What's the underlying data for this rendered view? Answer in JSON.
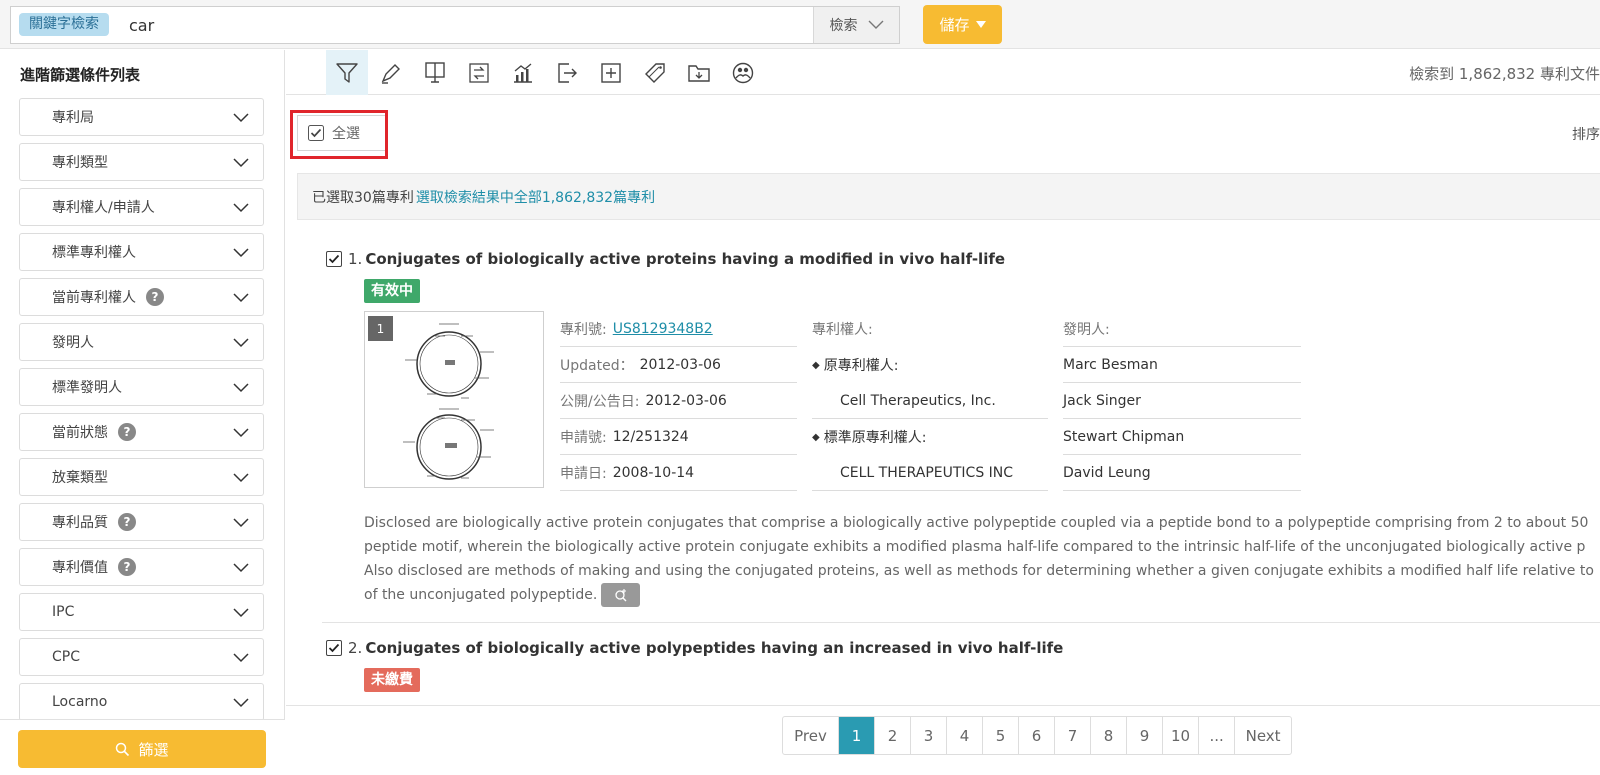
{
  "search": {
    "keyword_tag": "關鍵字檢索",
    "query": "car",
    "search_button": "檢索",
    "save_button": "儲存"
  },
  "sidebar": {
    "title": "進階篩選條件列表",
    "items": [
      {
        "label": "專利局",
        "help": false
      },
      {
        "label": "專利類型",
        "help": false
      },
      {
        "label": "專利權人/申請人",
        "help": false
      },
      {
        "label": "標準專利權人",
        "help": false
      },
      {
        "label": "當前專利權人",
        "help": true
      },
      {
        "label": "發明人",
        "help": false
      },
      {
        "label": "標準發明人",
        "help": false
      },
      {
        "label": "當前狀態",
        "help": true
      },
      {
        "label": "放棄類型",
        "help": false
      },
      {
        "label": "專利品質",
        "help": true
      },
      {
        "label": "專利價值",
        "help": true
      },
      {
        "label": "IPC",
        "help": false
      },
      {
        "label": "CPC",
        "help": false
      },
      {
        "label": "Locarno",
        "help": false
      }
    ],
    "filter_button": "篩選"
  },
  "toolbar": {
    "tools": [
      "filter-icon",
      "highlight-icon",
      "monitor-icon",
      "compare-icon",
      "chart-icon",
      "export-icon",
      "add-icon",
      "tag-icon",
      "folder-icon",
      "share-icon"
    ],
    "result_count": "檢索到 1,862,832 專利文件"
  },
  "list": {
    "select_all": "全選",
    "sort_label": "排序",
    "selected_text": "已選取30篇專利",
    "select_all_link": "選取檢索結果中全部1,862,832篇專利"
  },
  "patents": [
    {
      "number": "1.",
      "title": "Conjugates of biologically active proteins having a modified in vivo half-life",
      "status": "有效中",
      "thumb_badge": "1",
      "fields": [
        {
          "label": "專利號:",
          "value": "US8129348B2"
        },
        {
          "label": "Updated：",
          "value": "2012-03-06"
        },
        {
          "label": "公開/公告日:",
          "value": "2012-03-06"
        },
        {
          "label": "申請號:",
          "value": "12/251324"
        },
        {
          "label": "申請日:",
          "value": "2008-10-14"
        }
      ],
      "owner_header": "專利權人:",
      "original_owner_label": "原專利權人:",
      "original_owner": "Cell Therapeutics, Inc.",
      "std_owner_label": "標準原專利權人:",
      "std_owner": "CELL THERAPEUTICS INC",
      "inventor_header": "發明人:",
      "inventors": [
        "Marc Besman",
        "Jack Singer",
        "Stewart Chipman",
        "David Leung"
      ],
      "abstract_lines": [
        "Disclosed are biologically active protein conjugates that comprise a biologically active polypeptide coupled via a peptide bond to a polypeptide comprising from 2 to about 50",
        "peptide motif, wherein the biologically active protein conjugate exhibits a modified plasma half-life compared to the intrinsic half-life of the unconjugated biologically active p",
        "Also disclosed are methods of making and using the conjugated proteins, as well as methods for determining whether a given conjugate exhibits a modified half life relative to",
        "of the unconjugated polypeptide."
      ]
    },
    {
      "number": "2.",
      "title": "Conjugates of biologically active polypeptides having an increased in vivo half-life",
      "status": "未繳費"
    }
  ],
  "pagination": [
    "Prev",
    "1",
    "2",
    "3",
    "4",
    "5",
    "6",
    "7",
    "8",
    "9",
    "10",
    "...",
    "Next"
  ],
  "colors": {
    "accent": "#f7bb32",
    "active_page": "#2a9bb2",
    "link": "#1f8ea8",
    "status_active": "#3fa86a",
    "status_unpaid": "#e46b5c",
    "highlight": "#e0252b"
  }
}
